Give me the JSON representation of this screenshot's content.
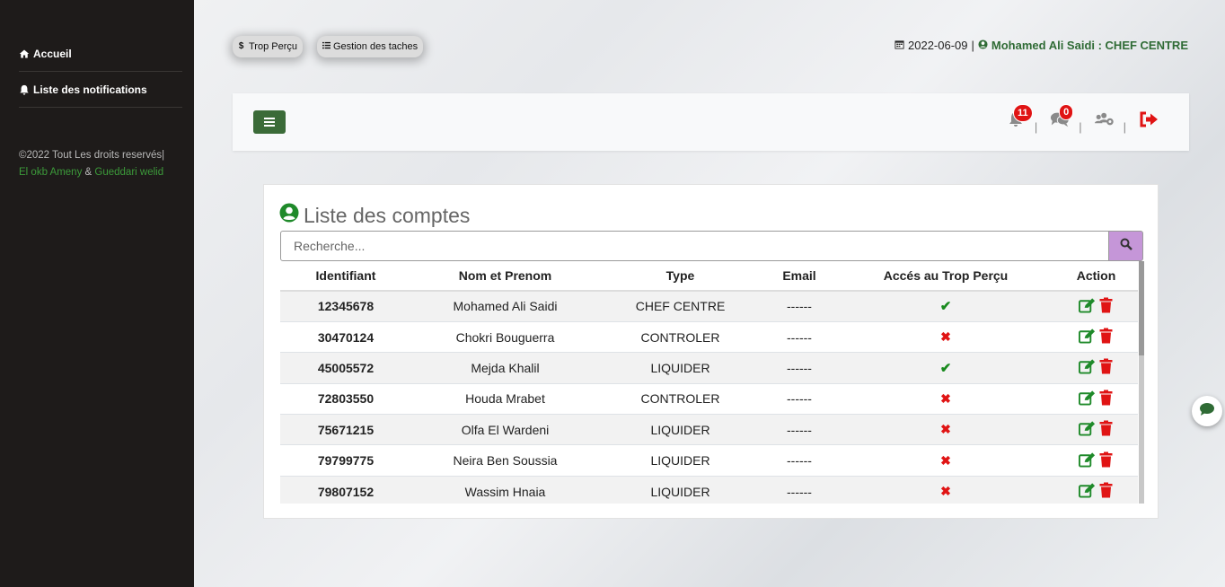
{
  "sidebar": {
    "items": [
      {
        "label": "Accueil",
        "icon": "home-icon"
      },
      {
        "label": "Liste des notifications",
        "icon": "bell-icon"
      }
    ],
    "copyright": "©2022 Tout Les droits reservés|",
    "author1": "El okb Ameny",
    "amp": "&",
    "author2": "Gueddari welid"
  },
  "header": {
    "pills": [
      {
        "label": "Trop Perçu",
        "icon": "dollar-icon"
      },
      {
        "label": "Gestion des taches",
        "icon": "list-icon"
      }
    ],
    "date": "2022-06-09",
    "separator": "|",
    "user": "Mohamed Ali Saidi : CHEF CENTRE"
  },
  "navbar": {
    "notifications_count": "11",
    "messages_count": "0",
    "sep": "|"
  },
  "card": {
    "title": "Liste des comptes",
    "search_placeholder": "Recherche...",
    "columns": [
      "Identifiant",
      "Nom et Prenom",
      "Type",
      "Email",
      "Accés au Trop Perçu",
      "Action"
    ],
    "rows": [
      {
        "id": "12345678",
        "name": "Mohamed Ali Saidi",
        "type": "CHEF CENTRE",
        "email": "------",
        "access": true
      },
      {
        "id": "30470124",
        "name": "Chokri Bouguerra",
        "type": "CONTROLER",
        "email": "------",
        "access": false
      },
      {
        "id": "45005572",
        "name": "Mejda Khalil",
        "type": "LIQUIDER",
        "email": "------",
        "access": true
      },
      {
        "id": "72803550",
        "name": "Houda Mrabet",
        "type": "CONTROLER",
        "email": "------",
        "access": false
      },
      {
        "id": "75671215",
        "name": "Olfa El Wardeni",
        "type": "LIQUIDER",
        "email": "------",
        "access": false
      },
      {
        "id": "79799775",
        "name": "Neira Ben Soussia",
        "type": "LIQUIDER",
        "email": "------",
        "access": false
      },
      {
        "id": "79807152",
        "name": "Wassim Hnaia",
        "type": "LIQUIDER",
        "email": "------",
        "access": false
      }
    ]
  },
  "colors": {
    "sidebar_bg": "#1e1b1a",
    "brand_green": "#3b6b38",
    "badge_red": "#e01414",
    "search_btn": "#c596d8"
  }
}
